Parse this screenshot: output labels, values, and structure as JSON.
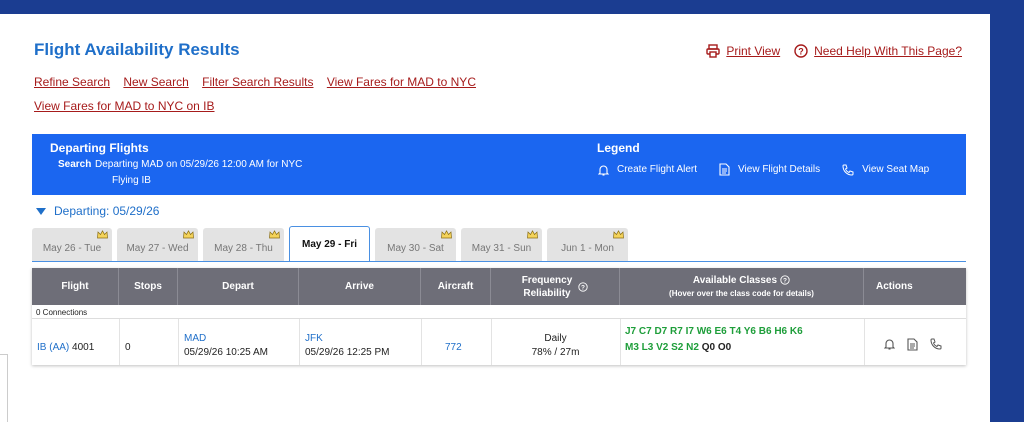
{
  "page": {
    "title": "Flight Availability Results",
    "print_view": "Print View",
    "help": "Need Help With This Page?"
  },
  "links_row1": [
    "Refine Search",
    "New Search",
    "Filter Search Results",
    "View Fares for MAD to NYC"
  ],
  "links_row2": [
    "View Fares for MAD to NYC on IB"
  ],
  "departing_panel": {
    "title": "Departing Flights",
    "search_label": "Search",
    "search_value": "Departing MAD on 05/29/26 12:00 AM for NYC",
    "search_value2": "Flying IB"
  },
  "legend": {
    "title": "Legend",
    "items": [
      "Create Flight Alert",
      "View Flight Details",
      "View Seat Map"
    ],
    "icons": [
      "bell-icon",
      "document-icon",
      "phone-icon"
    ]
  },
  "departing_toggle": "Departing: 05/29/26",
  "tabs": [
    "May 26 - Tue",
    "May 27 - Wed",
    "May 28 - Thu",
    "May 29 - Fri",
    "May 30 - Sat",
    "May 31 - Sun",
    "Jun 1 - Mon"
  ],
  "active_tab": "May 29 - Fri",
  "table": {
    "headers": {
      "flight": "Flight",
      "stops": "Stops",
      "depart": "Depart",
      "arrive": "Arrive",
      "aircraft": "Aircraft",
      "frequency": "Frequency",
      "reliability": "Reliability",
      "classes_title": "Available Classes",
      "classes_sub": "(Hover over the class code for details)",
      "actions": "Actions"
    },
    "connections": "0 Connections",
    "row": {
      "airline": "IB",
      "operating": "(AA)",
      "flight_no": "4001",
      "stops": "0",
      "depart_code": "MAD",
      "depart_time": "05/29/26 10:25 AM",
      "arrive_code": "JFK",
      "arrive_time": "05/29/26 12:25 PM",
      "aircraft": "772",
      "frequency": "Daily",
      "reliability": "78% / 27m",
      "classes_green_line1": "J7 C7 D7 R7 I7 W6 E6 T4 Y6 B6 H6 K6",
      "classes_green_line2": "M3 L3 V2 S2 N2",
      "classes_black_line2": "Q0 O0"
    }
  },
  "colors": {
    "brand_blue": "#1b66f0",
    "link_red": "#a61b1b",
    "header_gray": "#6e6e78",
    "class_green": "#1e9e3a"
  }
}
